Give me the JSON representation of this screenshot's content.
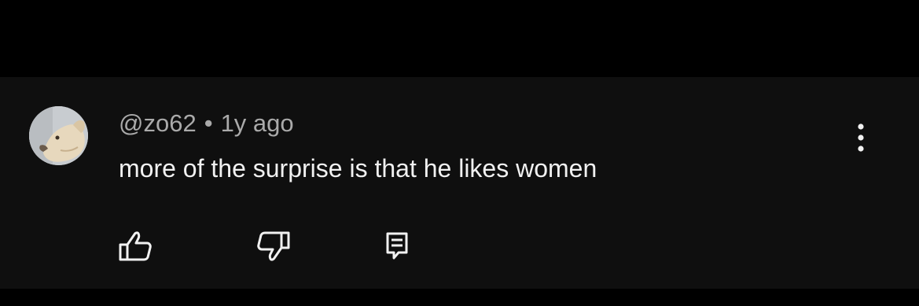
{
  "comment": {
    "author": "@zo62",
    "separator": "•",
    "timestamp": "1y ago",
    "text": "more of the surprise is that he likes women"
  },
  "icons": {
    "avatar": "dog-avatar",
    "more": "more-vertical-icon",
    "like": "thumbs-up-icon",
    "dislike": "thumbs-down-icon",
    "reply": "reply-comment-icon"
  },
  "colors": {
    "background": "#000000",
    "card": "#0f0f0f",
    "text_primary": "#f1f1f1",
    "text_secondary": "#aaaaaa",
    "icon": "#f1f1f1"
  }
}
